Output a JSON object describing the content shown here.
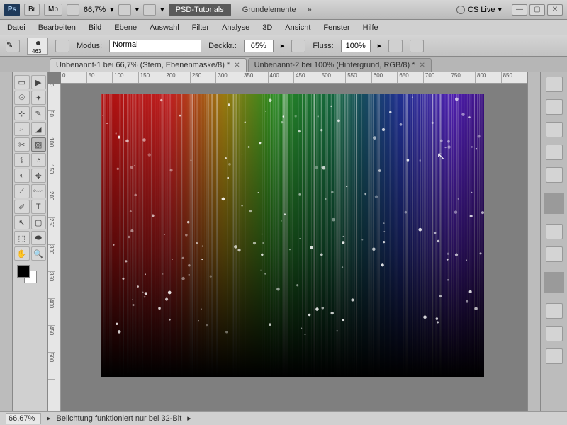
{
  "titlebar": {
    "logo": "Ps",
    "br": "Br",
    "mb": "Mb",
    "zoom": "66,7%",
    "tab_active": "PSD-Tutorials",
    "tab_other": "Grundelemente",
    "cslive": "CS Live"
  },
  "menu": [
    "Datei",
    "Bearbeiten",
    "Bild",
    "Ebene",
    "Auswahl",
    "Filter",
    "Analyse",
    "3D",
    "Ansicht",
    "Fenster",
    "Hilfe"
  ],
  "optbar": {
    "brush_size": "463",
    "mode_label": "Modus:",
    "mode_value": "Normal",
    "opacity_label": "Deckkr.:",
    "opacity_value": "65%",
    "flow_label": "Fluss:",
    "flow_value": "100%"
  },
  "tabs": [
    {
      "label": "Unbenannt-1 bei 66,7% (Stern, Ebenenmaske/8) *",
      "active": true
    },
    {
      "label": "Unbenannt-2 bei 100% (Hintergrund, RGB/8) *",
      "active": false
    }
  ],
  "ruler_h": [
    "0",
    "50",
    "100",
    "150",
    "200",
    "250",
    "300",
    "350",
    "400",
    "450",
    "500",
    "550",
    "600",
    "650",
    "700",
    "750",
    "800",
    "850"
  ],
  "ruler_v": [
    "0",
    "50",
    "100",
    "150",
    "200",
    "250",
    "300",
    "350",
    "400",
    "450",
    "500"
  ],
  "tools": [
    [
      "▭",
      "▶"
    ],
    [
      "℗",
      "✦"
    ],
    [
      "⊹",
      "✎"
    ],
    [
      "⌕",
      "◢"
    ],
    [
      "✂",
      "▨"
    ],
    [
      "⚕",
      "◔"
    ],
    [
      "◐",
      "✥"
    ],
    [
      "⟋",
      "⬳"
    ],
    [
      "✐",
      "T"
    ],
    [
      "↖",
      "▢"
    ],
    [
      "⬚",
      "⬬"
    ],
    [
      "✋",
      "🔍"
    ]
  ],
  "status": {
    "zoom": "66,67%",
    "hint": "Belichtung funktioniert nur bei 32-Bit"
  }
}
